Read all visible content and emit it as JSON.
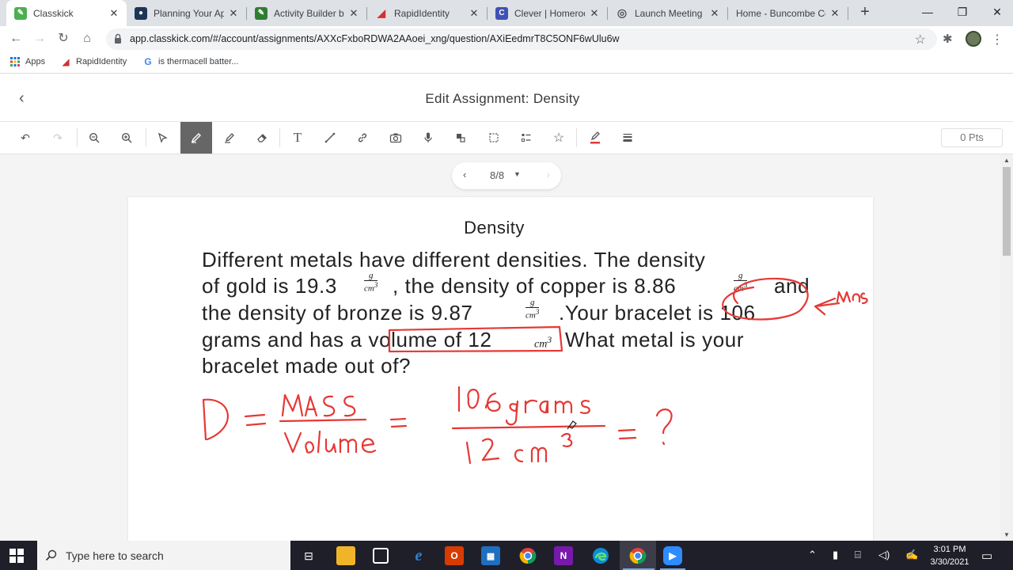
{
  "browser": {
    "tabs": [
      {
        "title": "Classkick",
        "color": "#4caf50",
        "glyph": "✎",
        "active": true
      },
      {
        "title": "Planning Your App",
        "color": "#1d3557",
        "glyph": "●",
        "active": false
      },
      {
        "title": "Activity Builder by",
        "color": "#2e7d32",
        "glyph": "✎",
        "active": false
      },
      {
        "title": "RapidIdentity",
        "color": "#d32f2f",
        "glyph": "◢",
        "active": false
      },
      {
        "title": "Clever | Homeroom",
        "color": "#3f51b5",
        "glyph": "C",
        "active": false
      },
      {
        "title": "Launch Meeting -",
        "color": "#555555",
        "glyph": "◎",
        "active": false
      },
      {
        "title": "Home - Buncombe Co",
        "color": "#dee1e6",
        "glyph": "",
        "active": false
      }
    ],
    "url": "app.classkick.com/#/account/assignments/AXXcFxboRDWA2AAoei_xng/question/AXiEedmrT8C5ONF6wUlu6w",
    "bookmarks": [
      {
        "label": "Apps",
        "icon": "apps-icon"
      },
      {
        "label": "RapidIdentity",
        "icon": "rapididentity-icon"
      },
      {
        "label": "is thermacell batter...",
        "icon": "google-icon"
      }
    ]
  },
  "app": {
    "title": "Edit Assignment: Density",
    "points": "0 Pts",
    "pager": "8/8",
    "tools": [
      "undo-icon",
      "redo-icon",
      "zoom-out-icon",
      "zoom-in-icon",
      "select-icon",
      "pen-icon",
      "highlighter-icon",
      "eraser-icon",
      "text-icon",
      "line-icon",
      "link-icon",
      "camera-icon",
      "microphone-icon",
      "sticker-icon",
      "region-select-icon",
      "multiple-choice-icon",
      "star-icon",
      "pen-color-icon",
      "line-weight-icon"
    ]
  },
  "question": {
    "title": "Density",
    "lines": [
      "Different metals have different densities. The density",
      "of gold is 19.3",
      ", the density of copper is 8.86",
      "and",
      "the density of bronze is 9.87",
      ".Your bracelet is 106",
      "grams and has a volume of 12",
      "What metal is your",
      "bracelet made out of?"
    ],
    "unit_num": "g",
    "unit_den": "cm",
    "unit_exp": "3",
    "unit_cm3": "cm"
  },
  "annotations": {
    "arrow_note": "Mass",
    "formula_lhs": "D =",
    "formula_num": "Mass",
    "formula_den": "Volume",
    "calc_num": "106 grams",
    "calc_den": "12 cm³",
    "result": "= ?",
    "ink_color": "#e53935"
  },
  "taskbar": {
    "search_placeholder": "Type here to search",
    "time": "3:01 PM",
    "date": "3/30/2021"
  }
}
